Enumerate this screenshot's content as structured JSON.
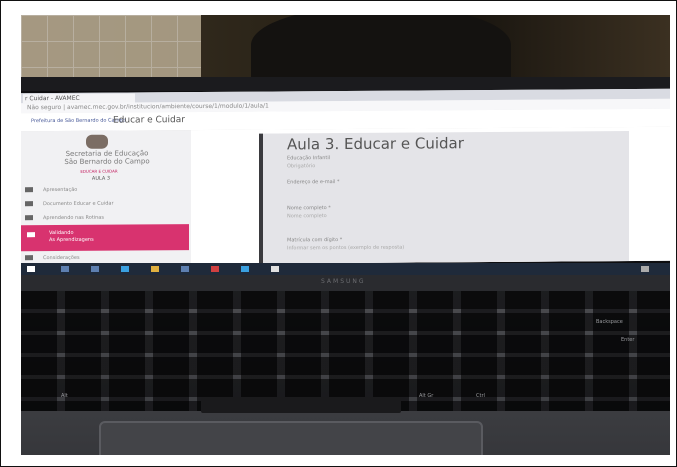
{
  "browser": {
    "tab_label": "r Cuidar - AVAMEC",
    "address": "Não seguro | avamec.mec.gov.br/institucion/ambiente/course/1/modulo/1/aula/1"
  },
  "site": {
    "logo_text": "Prefeitura de São Bernardo do Campo",
    "header_title": "Educar e Cuidar"
  },
  "sidebar": {
    "secretaria": "Secretaria de Educação\nSão Bernardo do Campo",
    "curso_label": "EDUCAR E CUIDAR",
    "aula_label": "AULA 3",
    "items": [
      {
        "label": "Apresentação"
      },
      {
        "label": "Documento Educar e Cuidar"
      },
      {
        "label": "Aprendendo nas Rotinas"
      },
      {
        "label": "Considerações"
      }
    ],
    "active_item": {
      "line1": "Validando",
      "line2": "As Aprendizagens"
    }
  },
  "content": {
    "title": "Aula 3. Educar e Cuidar",
    "subtitle": "Educação Infantil",
    "subtitle2": "Obrigatório",
    "fields": [
      {
        "label": "Endereço de e-mail *",
        "value": ""
      },
      {
        "label": "Nome completo *",
        "value": "Nome completo"
      },
      {
        "label": "Matrícula com dígito *",
        "value": "Informar sem os pontos (exemplo de resposta)"
      }
    ]
  },
  "laptop": {
    "brand": "SAMSUNG",
    "keys": [
      "Backspace",
      "Enter",
      "Alt Gr",
      "Ctrl",
      "Alt"
    ]
  }
}
